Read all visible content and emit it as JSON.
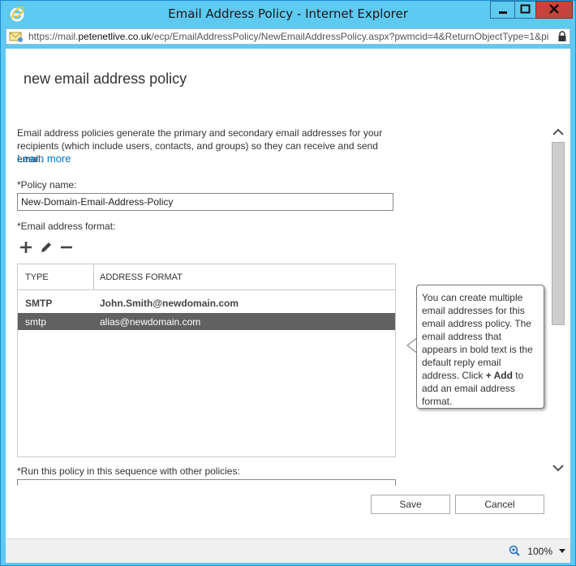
{
  "window": {
    "title": "Email Address Policy - Internet Explorer",
    "url_prefix": "https://mail.",
    "url_host": "petenetlive.co.uk",
    "url_path": "/ecp/EmailAddressPolicy/NewEmailAddressPolicy.aspx?pwmcid=4&ReturnObjectType=1&pi"
  },
  "page": {
    "heading": "new email address policy",
    "intro_text": "Email address policies generate the primary and secondary email addresses for your recipients (which include users, contacts, and groups) so they can receive and send email.",
    "learn_more": "Learn more",
    "policy_name_label": "*Policy name:",
    "policy_name_value": "New-Domain-Email-Address-Policy",
    "email_format_label": "*Email address format:",
    "sequence_label": "*Run this policy in this sequence with other policies:"
  },
  "table": {
    "columns": [
      "TYPE",
      "ADDRESS FORMAT"
    ],
    "rows": [
      {
        "type": "SMTP",
        "address": "John.Smith@newdomain.com"
      },
      {
        "type": "smtp",
        "address": "alias@newdomain.com"
      }
    ]
  },
  "callout": {
    "text_before": "You can create multiple email addresses for this email address policy. The email address that appears in bold text is the default reply email address. Click ",
    "bold": "+ Add",
    "text_after": " to add an email address format."
  },
  "buttons": {
    "save": "Save",
    "cancel": "Cancel"
  },
  "statusbar": {
    "zoom": "100%"
  },
  "icons": {
    "browser": "ie-logo-icon",
    "add": "plus-icon",
    "edit": "pencil-icon",
    "remove": "minus-icon"
  },
  "colors": {
    "titlebar": "#5ec9f1",
    "close_button": "#c7433b",
    "link": "#0072c6",
    "selected_row": "#616161"
  }
}
